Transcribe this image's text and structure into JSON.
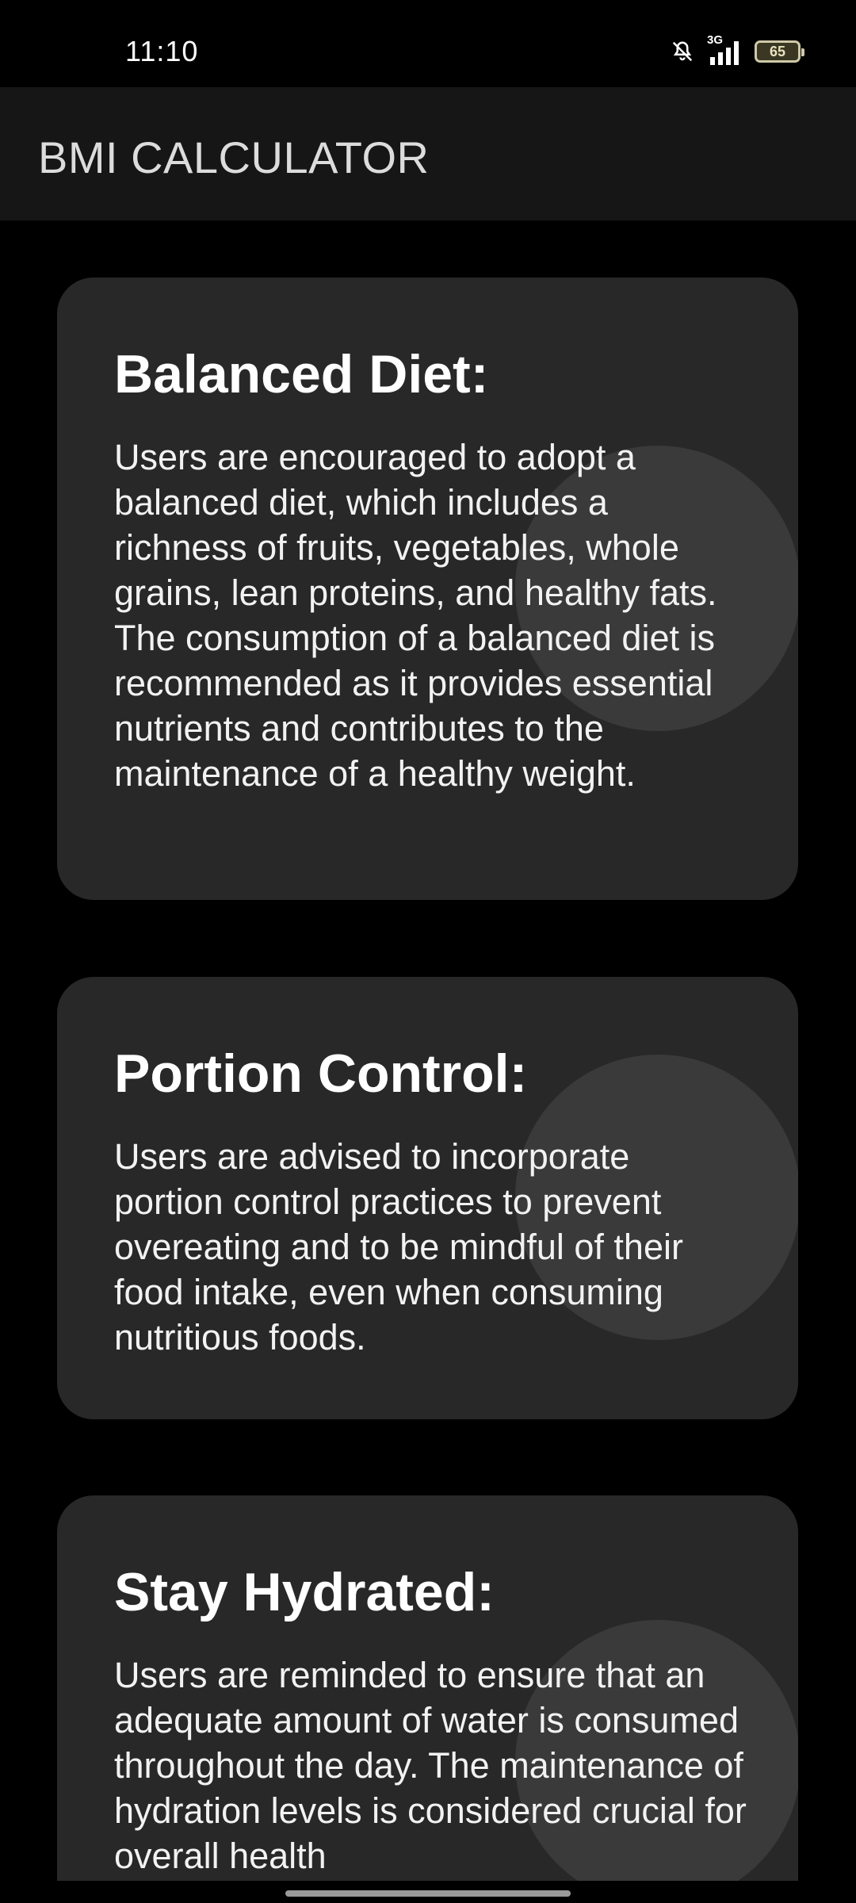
{
  "status_bar": {
    "time": "11:10",
    "network": "3G",
    "battery": "65",
    "icons": [
      "bell-off-icon",
      "signal-3g-icon",
      "battery-icon"
    ]
  },
  "app_bar": {
    "title": "BMI CALCULATOR"
  },
  "cards": [
    {
      "title": "Balanced Diet:",
      "body": "Users are encouraged to adopt a balanced diet, which includes a richness of fruits, vegetables, whole grains, lean proteins, and healthy fats. The consumption of a balanced diet is recommended as it provides essential nutrients and contributes to the maintenance of a healthy weight."
    },
    {
      "title": "Portion Control:",
      "body": "Users are advised to incorporate portion control practices to prevent overeating and to be mindful of their food intake, even when consuming nutritious foods."
    },
    {
      "title": "Stay Hydrated:",
      "body": "Users are reminded to ensure that an adequate amount of water is consumed throughout the day. The maintenance of hydration levels is considered crucial for overall health"
    }
  ],
  "colors": {
    "background": "#000000",
    "app_bar": "#161616",
    "card": "#282828",
    "card_accent_circle": "#3a3a3a",
    "text": "#ffffff"
  }
}
